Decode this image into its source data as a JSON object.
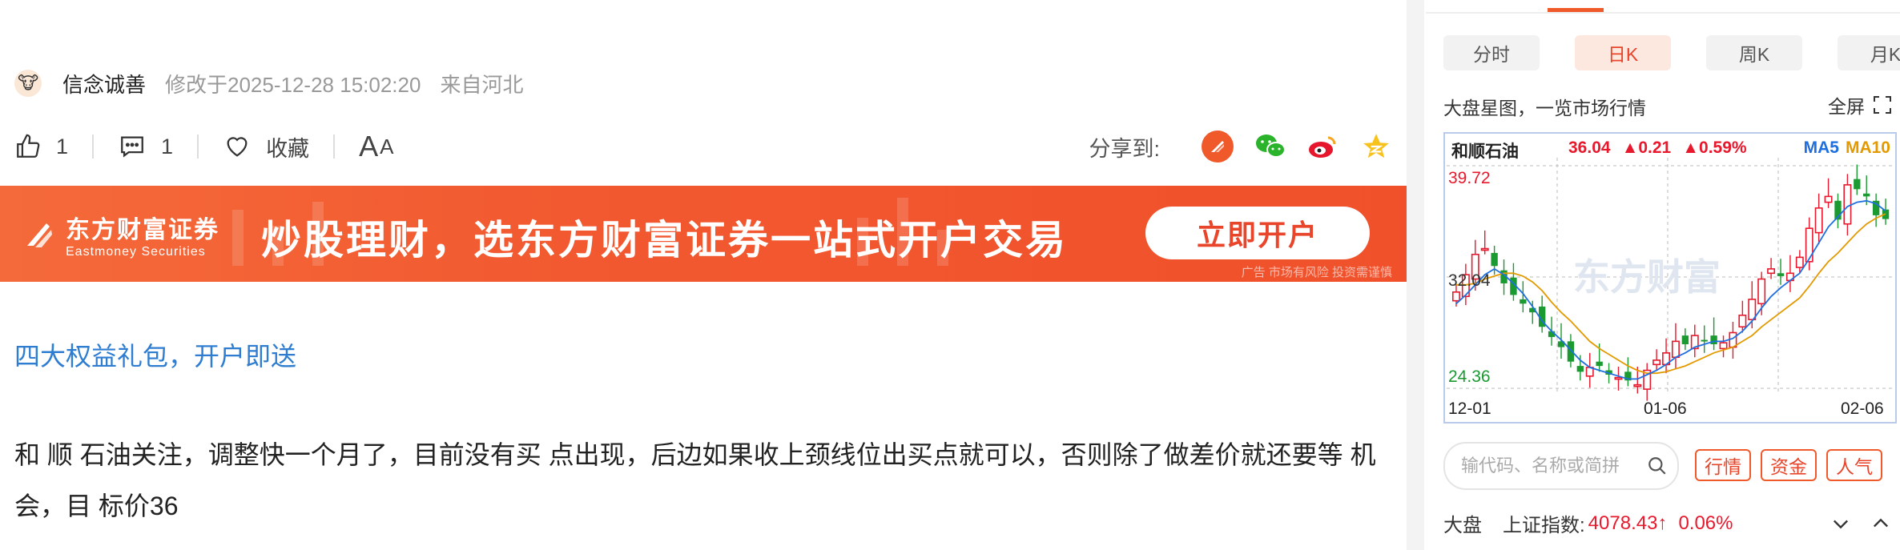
{
  "article": {
    "author": "信念诚善",
    "modified": "修改于2025-12-28 15:02:20",
    "location": "来自河北",
    "likes": "1",
    "comments": "1",
    "favorite_label": "收藏",
    "font_size_label_big": "A",
    "font_size_label_small": "A",
    "share_label": "分享到:",
    "promo_link": "四大权益礼包，开户即送",
    "body_line1": "和 顺 石油关注，调整快一个月了，目前没有买 点出现，后边如果收上颈线位出买点就可以，否则除了做差价就还要等 机",
    "body_line2": "会，目  标价36"
  },
  "banner": {
    "logo_cn": "东方财富证券",
    "logo_en": "Eastmoney Securities",
    "title": "炒股理财，选东方财富证券一站式开户交易",
    "button": "立即开户",
    "note": "广告 市场有风险 投资需谨慎",
    "colors": {
      "bg": "#f25930",
      "button_text": "#e8452a"
    }
  },
  "panel": {
    "tabs": [
      {
        "label": "分时",
        "active": false
      },
      {
        "label": "日K",
        "active": true
      },
      {
        "label": "周K",
        "active": false
      },
      {
        "label": "月K",
        "active": false
      }
    ],
    "title": "大盘星图，一览市场行情",
    "fullscreen": "全屏",
    "search_placeholder": "输代码、名称或简拼",
    "quick_buttons": [
      "行情",
      "资金",
      "人气"
    ],
    "index_label": "大盘",
    "index_name": "上证指数:",
    "index_value": "4078.43↑",
    "index_change": "0.06%"
  },
  "chart_data": {
    "type": "candlestick",
    "stock": "和顺石油",
    "price": "36.04",
    "change": "▲0.21",
    "change_pct": "▲0.59%",
    "legend": [
      "MA5",
      "MA10"
    ],
    "colors": {
      "up": "#e8182d",
      "down": "#1a9a30",
      "ma5": "#1f6fe0",
      "ma10": "#e39a00"
    },
    "y_labels": [
      "39.72",
      "32.04",
      "24.36"
    ],
    "x_labels": [
      "12-01",
      "01-06",
      "02-06"
    ],
    "watermark": "东方财富",
    "close": [
      31.0,
      32.2,
      33.6,
      34.0,
      32.8,
      31.6,
      30.8,
      30.2,
      29.6,
      28.6,
      27.9,
      27.2,
      26.2,
      25.5,
      25.8,
      25.9,
      25.3,
      25.1,
      24.9,
      24.6,
      25.6,
      26.3,
      26.8,
      27.6,
      27.4,
      28.0,
      27.6,
      27.4,
      27.5,
      28.2,
      29.4,
      30.5,
      31.9,
      32.6,
      32.1,
      32.3,
      33.4,
      35.4,
      36.8,
      37.6,
      36.0,
      38.4,
      38.1,
      37.6,
      36.3,
      36.04
    ],
    "ma5": [
      30.2,
      30.8,
      31.5,
      32.2,
      32.6,
      32.2,
      31.6,
      30.9,
      30.0,
      29.0,
      28.3,
      27.7,
      27.0,
      26.3,
      25.8,
      25.6,
      25.4,
      25.2,
      25.0,
      25.0,
      25.3,
      25.6,
      26.0,
      26.5,
      26.8,
      27.2,
      27.4,
      27.6,
      27.6,
      27.8,
      28.3,
      29.0,
      29.9,
      30.7,
      31.3,
      31.8,
      32.3,
      33.3,
      34.4,
      35.5,
      36.2,
      36.9,
      37.2,
      37.3,
      37.1,
      36.6
    ],
    "ma10": [
      31.5,
      31.5,
      31.6,
      31.9,
      32.1,
      32.3,
      32.3,
      32.1,
      31.7,
      31.1,
      30.3,
      29.6,
      29.0,
      28.3,
      27.6,
      27.1,
      26.7,
      26.3,
      25.9,
      25.6,
      25.4,
      25.4,
      25.5,
      25.7,
      25.9,
      26.2,
      26.5,
      26.8,
      27.0,
      27.2,
      27.6,
      28.0,
      28.6,
      29.1,
      29.6,
      30.1,
      30.6,
      31.4,
      32.3,
      33.1,
      33.7,
      34.4,
      35.1,
      35.7,
      36.1,
      36.4
    ]
  }
}
